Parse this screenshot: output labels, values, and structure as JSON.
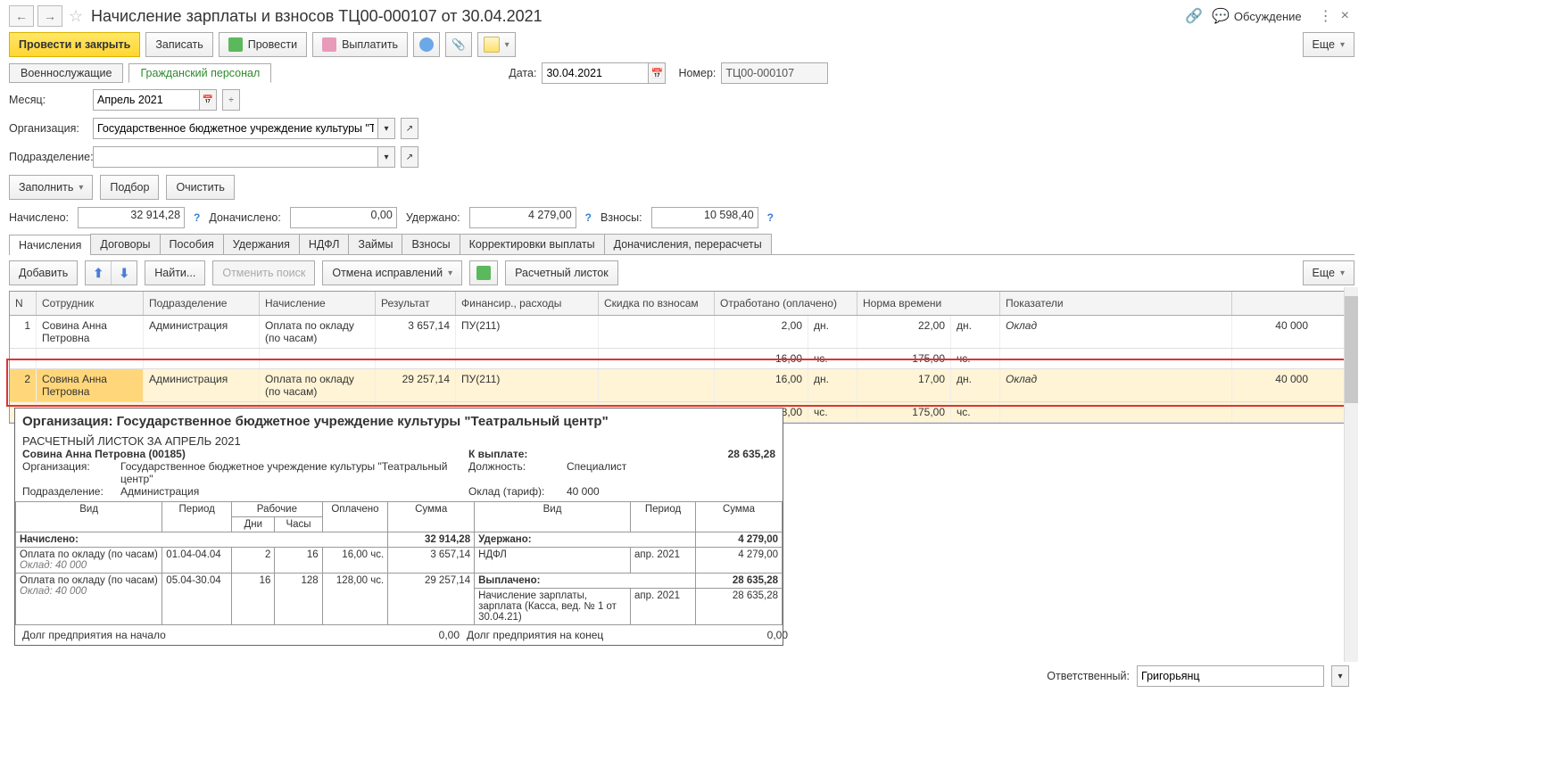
{
  "titlebar": {
    "title": "Начисление зарплаты и взносов ТЦ00-000107 от 30.04.2021",
    "discuss": "Обсуждение"
  },
  "cmd": {
    "post_close": "Провести и закрыть",
    "save": "Записать",
    "post": "Провести",
    "pay": "Выплатить",
    "more": "Еще"
  },
  "ptabs": {
    "mil": "Военнослужащие",
    "civ": "Гражданский персонал"
  },
  "date_label": "Дата:",
  "date_value": "30.04.2021",
  "num_label": "Номер:",
  "num_value": "ТЦ00-000107",
  "month_label": "Месяц:",
  "month_value": "Апрель 2021",
  "org_label": "Организация:",
  "org_value": "Государственное бюджетное учреждение культуры \"Театрал",
  "dep_label": "Подразделение:",
  "dep_value": "",
  "fillbtns": {
    "fill": "Заполнить",
    "pick": "Подбор",
    "clear": "Очистить"
  },
  "totals": {
    "accrued_l": "Начислено:",
    "accrued": "32 914,28",
    "extra_l": "Доначислено:",
    "extra": "0,00",
    "held_l": "Удержано:",
    "held": "4 279,00",
    "contr_l": "Взносы:",
    "contr": "10 598,40"
  },
  "sectabs": [
    "Начисления",
    "Договоры",
    "Пособия",
    "Удержания",
    "НДФЛ",
    "Займы",
    "Взносы",
    "Корректировки выплаты",
    "Доначисления, перерасчеты"
  ],
  "gridbar": {
    "add": "Добавить",
    "find": "Найти...",
    "cancel_search": "Отменить поиск",
    "cancel_fix": "Отмена исправлений",
    "payslip": "Расчетный листок",
    "more": "Еще"
  },
  "gridhead": [
    "N",
    "Сотрудник",
    "Подразделение",
    "Начисление",
    "Результат",
    "Финансир., расходы",
    "Скидка по взносам",
    "Отработано (оплачено)",
    "Норма времени",
    "Показатели"
  ],
  "rows": [
    {
      "n": "1",
      "emp": "Совина Анна Петровна",
      "dep": "Администрация",
      "acc": "Оплата по окладу (по часам)",
      "res": "3 657,14",
      "fin": "ПУ(211)",
      "disc": "",
      "w1": "2,00",
      "w1u": "дн.",
      "w2": "16,00",
      "w2u": "чс.",
      "n1": "22,00",
      "n1u": "дн.",
      "n2": "175,00",
      "n2u": "чс.",
      "ind": "Оклад",
      "indv": "40 000"
    },
    {
      "n": "2",
      "emp": "Совина Анна Петровна",
      "dep": "Администрация",
      "acc": "Оплата по окладу (по часам)",
      "res": "29 257,14",
      "fin": "ПУ(211)",
      "disc": "",
      "w1": "16,00",
      "w1u": "дн.",
      "w2": "128,00",
      "w2u": "чс.",
      "n1": "17,00",
      "n1u": "дн.",
      "n2": "175,00",
      "n2u": "чс.",
      "ind": "Оклад",
      "indv": "40 000"
    }
  ],
  "payslip": {
    "org_title": "Организация: Государственное бюджетное учреждение культуры \"Театральный центр\"",
    "subtitle": "РАСЧЕТНЫЙ ЛИСТОК ЗА АПРЕЛЬ 2021",
    "person": "Совина Анна Петровна (00185)",
    "to_pay_l": "К выплате:",
    "to_pay": "28 635,28",
    "org_l": "Организация:",
    "org": "Государственное бюджетное учреждение культуры \"Театральный центр\"",
    "pos_l": "Должность:",
    "pos": "Специалист",
    "dep_l": "Подразделение:",
    "dep": "Администрация",
    "rate_l": "Оклад (тариф):",
    "rate": "40 000",
    "hd": {
      "type": "Вид",
      "period": "Период",
      "work": "Рабочие",
      "days": "Дни",
      "hours": "Часы",
      "paid": "Оплачено",
      "sum": "Сумма"
    },
    "left": {
      "accrued_l": "Начислено:",
      "accrued_v": "32 914,28",
      "r1": {
        "type": "Оплата по окладу (по часам)",
        "note": "Оклад: 40 000",
        "period": "01.04-04.04",
        "d": "2",
        "h": "16",
        "paid": "16,00 чс.",
        "sum": "3 657,14"
      },
      "r2": {
        "type": "Оплата по окладу (по часам)",
        "note": "Оклад: 40 000",
        "period": "05.04-30.04",
        "d": "16",
        "h": "128",
        "paid": "128,00 чс.",
        "sum": "29 257,14"
      }
    },
    "right": {
      "held_l": "Удержано:",
      "held_v": "4 279,00",
      "r1": {
        "type": "НДФЛ",
        "period": "апр. 2021",
        "sum": "4 279,00"
      },
      "paid_l": "Выплачено:",
      "paid_v": "28 635,28",
      "r2": {
        "type": "Начисление зарплаты, зарплата (Касса, вед. № 1 от 30.04.21)",
        "period": "апр. 2021",
        "sum": "28 635,28"
      }
    },
    "debtL": "Долг предприятия на начало",
    "debtLv": "0,00",
    "debtR": "Долг предприятия на конец",
    "debtRv": "0,00"
  },
  "footer": {
    "resp_l": "Ответственный:",
    "resp": "Григорьянц"
  }
}
